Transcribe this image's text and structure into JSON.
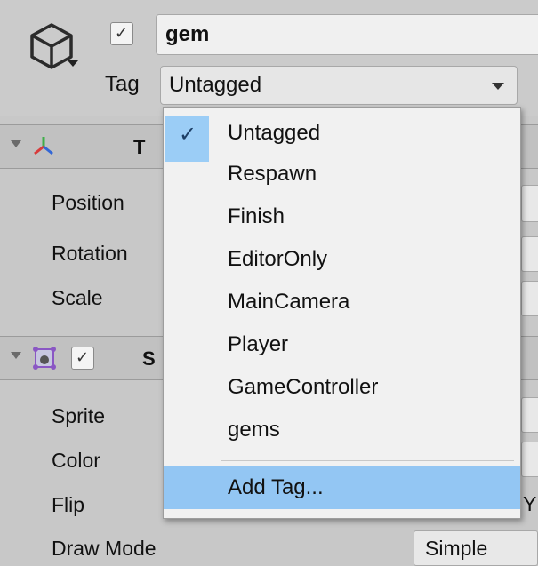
{
  "header": {
    "active_check": "✓",
    "name": "gem",
    "tag_label": "Tag",
    "tag_value": "Untagged"
  },
  "components": [
    {
      "title": "T",
      "properties": [
        "Position",
        "Rotation",
        "Scale"
      ]
    },
    {
      "title": "S",
      "enabled_check": "✓",
      "properties": [
        "Sprite",
        "Color",
        "Flip",
        "Draw Mode"
      ]
    }
  ],
  "flip_axis_partial": "Y",
  "draw_mode_value": "Simple",
  "tag_menu": {
    "check_mark": "✓",
    "items": [
      "Untagged",
      "Respawn",
      "Finish",
      "EditorOnly",
      "MainCamera",
      "Player",
      "GameController",
      "gems"
    ],
    "selected": "Untagged",
    "add_tag": "Add Tag..."
  },
  "colors": {
    "menu_highlight": "#93c6f3",
    "checked_background": "#9bcdf6",
    "transform_axis_red": "#d83b3b",
    "transform_axis_green": "#3fae49",
    "transform_axis_blue": "#3367d6",
    "sprite_icon_purple": "#8a57c4"
  }
}
